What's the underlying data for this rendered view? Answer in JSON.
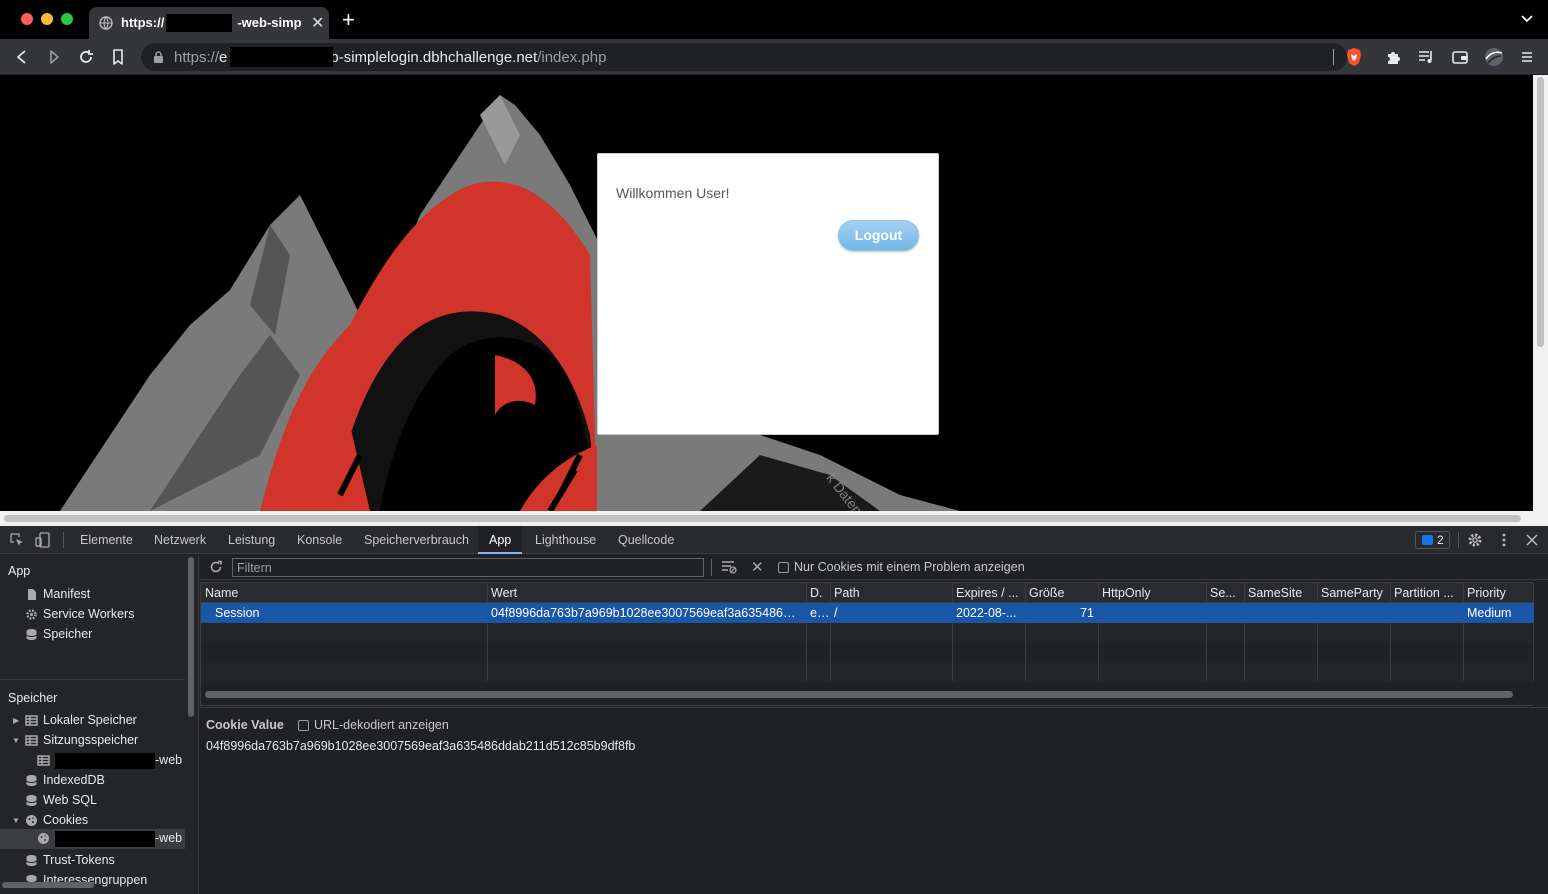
{
  "browser": {
    "tab_title": "https://",
    "tab_title_suffix": "-web-simpl",
    "url_scheme": "https://",
    "url_host_prefix": "e",
    "url_host_suffix": "b-simplelogin.dbhchallenge.net",
    "url_path": "/index.php"
  },
  "page": {
    "welcome_text": "Willkommen User!",
    "logout_label": "Logout",
    "watermark": "k Datentechnik"
  },
  "devtools": {
    "tabs": [
      "Elemente",
      "Netzwerk",
      "Leistung",
      "Konsole",
      "Speicherverbrauch",
      "App",
      "Lighthouse",
      "Quellcode"
    ],
    "active_tab": "App",
    "issues_count": "2",
    "sidebar": {
      "app_header": "App",
      "app_items": [
        "Manifest",
        "Service Workers",
        "Speicher"
      ],
      "storage_header": "Speicher",
      "local_storage": "Lokaler Speicher",
      "session_storage": "Sitzungsspeicher",
      "session_child_suffix": "-web",
      "indexeddb": "IndexedDB",
      "websql": "Web SQL",
      "cookies": "Cookies",
      "cookie_child_suffix": "-web",
      "trust_tokens": "Trust-Tokens",
      "interest_groups": "Interessengruppen"
    },
    "filter": {
      "placeholder": "Filtern",
      "only_issues_label": "Nur Cookies mit einem Problem anzeigen"
    },
    "table": {
      "columns": [
        "Name",
        "Wert",
        "D.",
        "Path",
        "Expires / ...",
        "Größe",
        "HttpOnly",
        "Se...",
        "SameSite",
        "SameParty",
        "Partition ...",
        "Priority"
      ],
      "rows": [
        {
          "name": "Session",
          "value": "04f8996da763b7a969b1028ee3007569eaf3a635486dd...",
          "domain": "e...",
          "path": "/",
          "expires": "2022-08-...",
          "size": "71",
          "httponly": "",
          "secure": "",
          "samesite": "",
          "sameparty": "",
          "partition": "",
          "priority": "Medium"
        }
      ]
    },
    "cookie_value": {
      "title": "Cookie Value",
      "decode_label": "URL-dekodiert anzeigen",
      "value": "04f8996da763b7a969b1028ee3007569eaf3a635486ddab211d512c85b9df8fb"
    }
  }
}
